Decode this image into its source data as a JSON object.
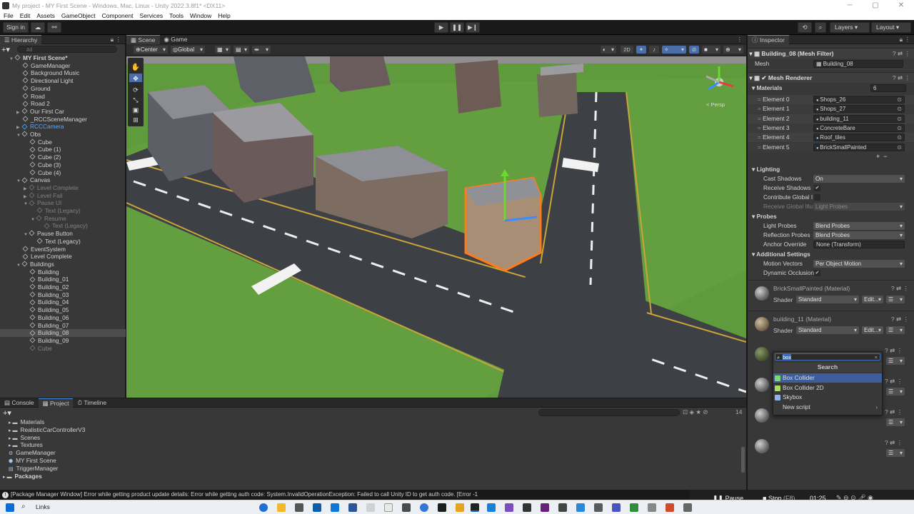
{
  "title_bar": {
    "title": "My project - MY First Scene - Windows, Mac, Linux - Unity 2022.3.8f1* <DX11>"
  },
  "menu": [
    "File",
    "Edit",
    "Assets",
    "GameObject",
    "Component",
    "Services",
    "Tools",
    "Window",
    "Help"
  ],
  "toolbar": {
    "sign_in": "Sign in",
    "layers": "Layers",
    "layout": "Layout"
  },
  "hierarchy": {
    "tab": "Hierarchy",
    "search_placeholder": "All",
    "rows": [
      {
        "label": "MY First Scene*",
        "depth": 0,
        "arrow": "▼",
        "icon": "unity"
      },
      {
        "label": "GameManager",
        "depth": 1
      },
      {
        "label": "Background Music",
        "depth": 1
      },
      {
        "label": "Directional Light",
        "depth": 1
      },
      {
        "label": "Ground",
        "depth": 1
      },
      {
        "label": "Road",
        "depth": 1
      },
      {
        "label": "Road 2",
        "depth": 1
      },
      {
        "label": "Our First Car",
        "depth": 1,
        "arrow": "▶"
      },
      {
        "label": "_RCCSceneManager",
        "depth": 1
      },
      {
        "label": "RCCCamera",
        "depth": 1,
        "arrow": "▶",
        "style": "blue"
      },
      {
        "label": "Obs",
        "depth": 1,
        "arrow": "▼"
      },
      {
        "label": "Cube",
        "depth": 2
      },
      {
        "label": "Cube (1)",
        "depth": 2
      },
      {
        "label": "Cube (2)",
        "depth": 2
      },
      {
        "label": "Cube (3)",
        "depth": 2
      },
      {
        "label": "Cube (4)",
        "depth": 2
      },
      {
        "label": "Canvas",
        "depth": 1,
        "arrow": "▼"
      },
      {
        "label": "Level Complete",
        "depth": 2,
        "arrow": "▶",
        "style": "dim"
      },
      {
        "label": "Level Fail",
        "depth": 2,
        "arrow": "▶",
        "style": "dim"
      },
      {
        "label": "Pause UI",
        "depth": 2,
        "arrow": "▼",
        "style": "dim"
      },
      {
        "label": "Text (Legacy)",
        "depth": 3,
        "style": "dim"
      },
      {
        "label": "Resume",
        "depth": 3,
        "arrow": "▼",
        "style": "dim"
      },
      {
        "label": "Text (Legacy)",
        "depth": 4,
        "style": "dim"
      },
      {
        "label": "Pause Button",
        "depth": 2,
        "arrow": "▼"
      },
      {
        "label": "Text (Legacy)",
        "depth": 3
      },
      {
        "label": "EventSystem",
        "depth": 1
      },
      {
        "label": "Level Complete",
        "depth": 1
      },
      {
        "label": "Buildings",
        "depth": 1,
        "arrow": "▼"
      },
      {
        "label": "Building",
        "depth": 2
      },
      {
        "label": "Building_01",
        "depth": 2
      },
      {
        "label": "Building_02",
        "depth": 2
      },
      {
        "label": "Building_03",
        "depth": 2
      },
      {
        "label": "Building_04",
        "depth": 2
      },
      {
        "label": "Building_05",
        "depth": 2
      },
      {
        "label": "Building_06",
        "depth": 2
      },
      {
        "label": "Building_07",
        "depth": 2
      },
      {
        "label": "Building_08",
        "depth": 2,
        "style": "sel"
      },
      {
        "label": "Building_09",
        "depth": 2
      },
      {
        "label": "Cube",
        "depth": 2,
        "style": "dim"
      }
    ]
  },
  "scene": {
    "tab_scene": "Scene",
    "tab_game": "Game",
    "pivot": "Center",
    "space": "Global",
    "mode_2d": "2D",
    "persp": "< Persp"
  },
  "bottom": {
    "tabs": [
      "Console",
      "Project",
      "Timeline"
    ],
    "badge": "14",
    "items": [
      {
        "label": "Materials",
        "kind": "folder"
      },
      {
        "label": "RealisticCarControllerV3",
        "kind": "folder"
      },
      {
        "label": "Scenes",
        "kind": "folder"
      },
      {
        "label": "Textures",
        "kind": "folder"
      },
      {
        "label": "GameManager",
        "kind": "prefab"
      },
      {
        "label": "MY First Scene",
        "kind": "scene"
      },
      {
        "label": "TriggerManager",
        "kind": "script"
      },
      {
        "label": "Packages",
        "kind": "root"
      }
    ]
  },
  "inspector": {
    "tab": "Inspector",
    "mesh_filter": {
      "title": "Building_08 (Mesh Filter)",
      "mesh_label": "Mesh",
      "mesh_value": "Building_08"
    },
    "mesh_renderer": {
      "title": "Mesh Renderer",
      "materials_label": "Materials",
      "materials_count": "6",
      "elements": [
        {
          "label": "Element 0",
          "value": "Shops_26"
        },
        {
          "label": "Element 1",
          "value": "Shops_27"
        },
        {
          "label": "Element 2",
          "value": "building_11"
        },
        {
          "label": "Element 3",
          "value": "ConcreteBare"
        },
        {
          "label": "Element 4",
          "value": "Roof_tiles"
        },
        {
          "label": "Element 5",
          "value": "BrickSmallPainted"
        }
      ],
      "lighting": "Lighting",
      "cast_shadows_label": "Cast Shadows",
      "cast_shadows_value": "On",
      "receive_shadows_label": "Receive Shadows",
      "contribute_label": "Contribute Global I",
      "receive_gi_label": "Receive Global Illu",
      "receive_gi_value": "Light Probes",
      "probes": "Probes",
      "light_probes_label": "Light Probes",
      "light_probes_value": "Blend Probes",
      "reflection_label": "Reflection Probes",
      "reflection_value": "Blend Probes",
      "anchor_label": "Anchor Override",
      "anchor_value": "None (Transform)",
      "additional": "Additional Settings",
      "motion_label": "Motion Vectors",
      "motion_value": "Per Object Motion",
      "dynamic_label": "Dynamic Occlusion"
    },
    "materials": [
      {
        "title": "BrickSmallPainted (Material)",
        "shader_label": "Shader",
        "shader_value": "Standard",
        "edit": "Edit..."
      },
      {
        "title": "building_11 (Material)",
        "shader_label": "Shader",
        "shader_value": "Standard",
        "edit": "Edit..."
      }
    ]
  },
  "add_component": {
    "query": "box",
    "header": "Search",
    "items": [
      {
        "label": "Box Collider",
        "icon_color": "#7fd66b"
      },
      {
        "label": "Box Collider 2D",
        "icon_color": "#a5e05a"
      },
      {
        "label": "Skybox",
        "icon_color": "#8ab4f0"
      },
      {
        "label": "New script",
        "icon_color": ""
      }
    ]
  },
  "status": {
    "message": "[Package Manager Window] Error while getting product update details: Error while getting auth code: System.InvalidOperationException: Failed to call Unity ID to get auth code. [Error -1"
  },
  "recorder": {
    "pause": "Pause",
    "stop": "Stop",
    "stop_key": "(F8)",
    "time": "01:25"
  },
  "taskbar": {
    "search_label": "Links"
  }
}
